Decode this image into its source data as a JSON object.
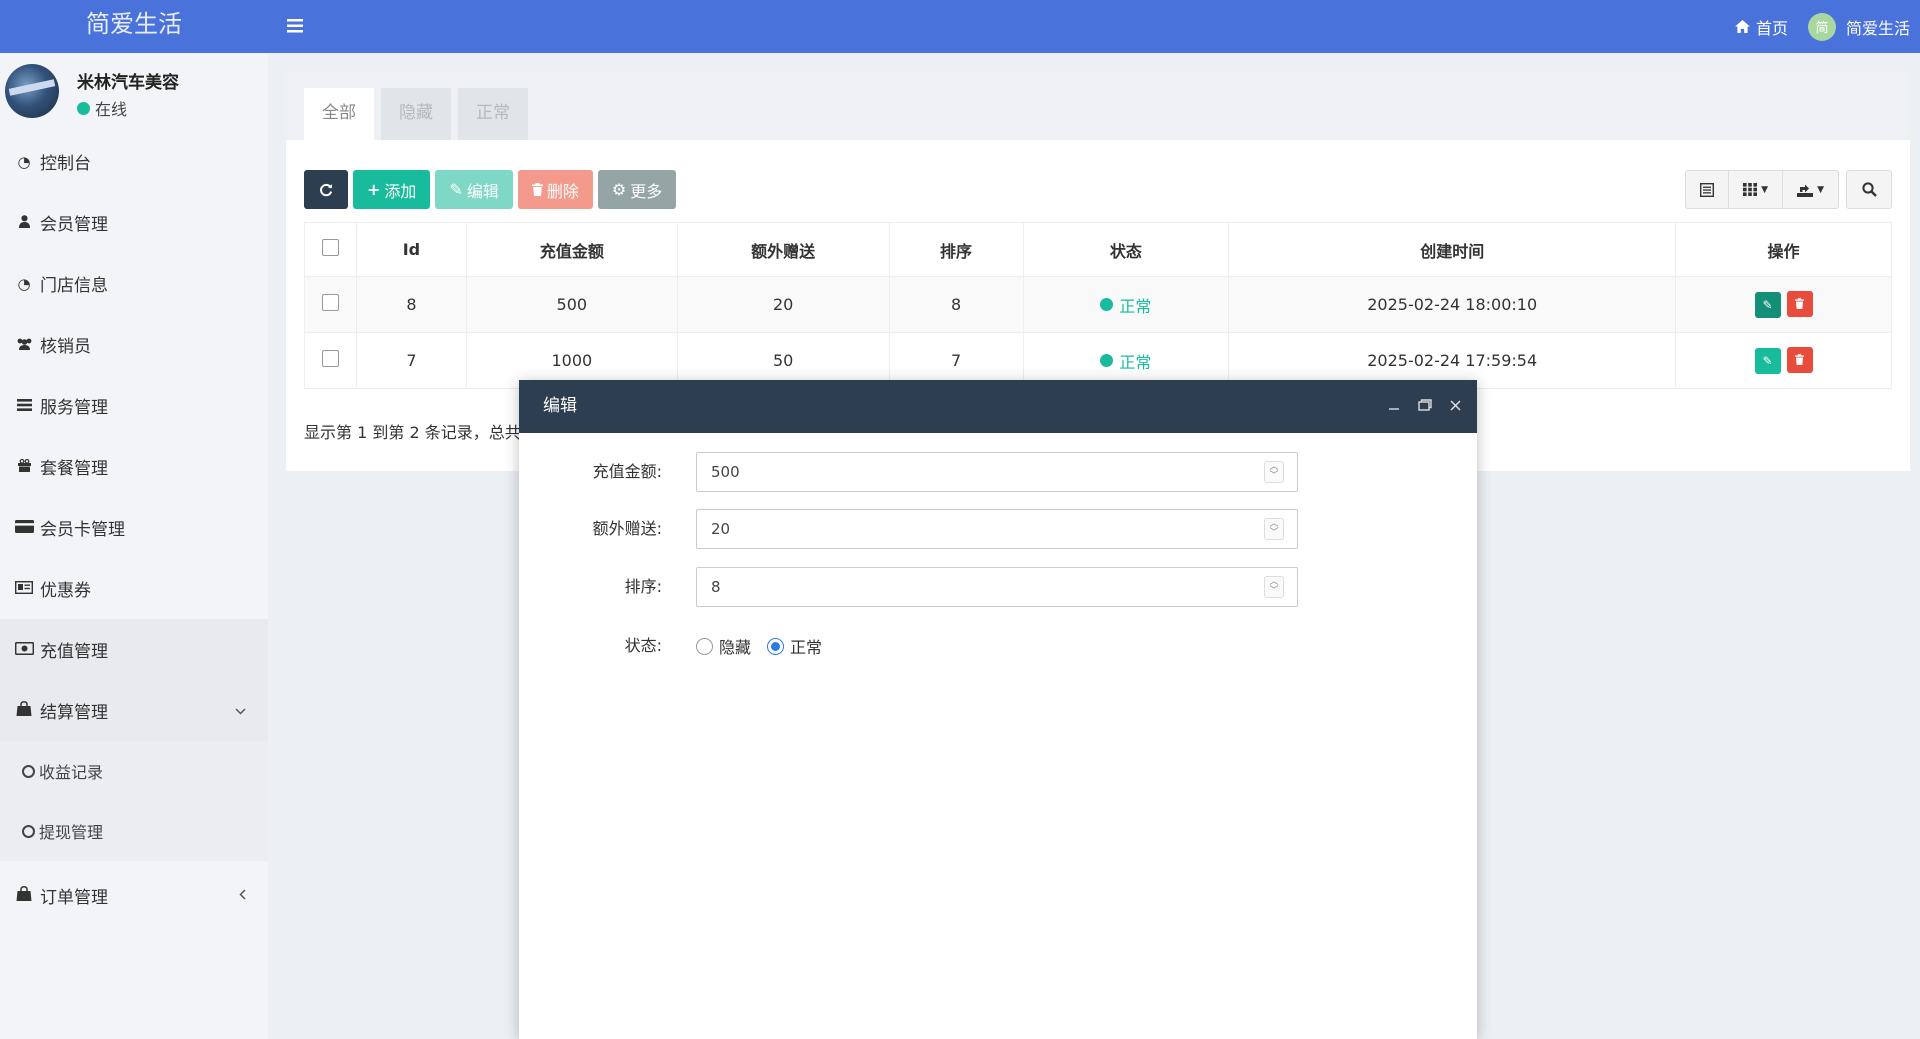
{
  "app": {
    "title": "简爱生活"
  },
  "topbar": {
    "home_label": "首页",
    "user_name": "简爱生活",
    "avatar_char": "简"
  },
  "profile": {
    "name": "米林汽车美容",
    "status": "在线"
  },
  "sidebar": {
    "items": [
      {
        "label": "控制台",
        "icon": "dashboard-icon"
      },
      {
        "label": "会员管理",
        "icon": "user-icon"
      },
      {
        "label": "门店信息",
        "icon": "dashboard-icon"
      },
      {
        "label": "核销员",
        "icon": "users-icon"
      },
      {
        "label": "服务管理",
        "icon": "list-icon"
      },
      {
        "label": "套餐管理",
        "icon": "gift-icon"
      },
      {
        "label": "会员卡管理",
        "icon": "credit-card-icon"
      },
      {
        "label": "优惠券",
        "icon": "id-card-icon"
      },
      {
        "label": "充值管理",
        "icon": "money-icon",
        "active": true
      },
      {
        "label": "结算管理",
        "icon": "shopping-bag-icon",
        "expanded": true
      },
      {
        "label": "订单管理",
        "icon": "shopping-bag-icon"
      }
    ],
    "sub_items": [
      {
        "label": "收益记录"
      },
      {
        "label": "提现管理"
      }
    ]
  },
  "tabs": [
    {
      "label": "全部",
      "active": true
    },
    {
      "label": "隐藏"
    },
    {
      "label": "正常"
    }
  ],
  "toolbar": {
    "add_label": "添加",
    "edit_label": "编辑",
    "delete_label": "删除",
    "more_label": "更多"
  },
  "table": {
    "columns": [
      "Id",
      "充值金额",
      "额外赠送",
      "排序",
      "状态",
      "创建时间",
      "操作"
    ],
    "rows": [
      {
        "id": "8",
        "amount": "500",
        "bonus": "20",
        "sort": "8",
        "status": "正常",
        "created": "2025-02-24 18:00:10"
      },
      {
        "id": "7",
        "amount": "1000",
        "bonus": "50",
        "sort": "7",
        "status": "正常",
        "created": "2025-02-24 17:59:54"
      }
    ],
    "footer": "显示第 1 到第 2 条记录，总共"
  },
  "modal": {
    "title": "编辑",
    "fields": {
      "amount_label": "充值金额:",
      "amount_value": "500",
      "bonus_label": "额外赠送:",
      "bonus_value": "20",
      "sort_label": "排序:",
      "sort_value": "8",
      "status_label": "状态:",
      "status_options": [
        "隐藏",
        "正常"
      ],
      "status_selected": "正常"
    }
  },
  "colors": {
    "topbar": "#4a72db",
    "accent_green": "#18bc9c",
    "dark": "#2c3e50",
    "danger": "#e74c3c",
    "radio_blue": "#2d7ce6"
  }
}
